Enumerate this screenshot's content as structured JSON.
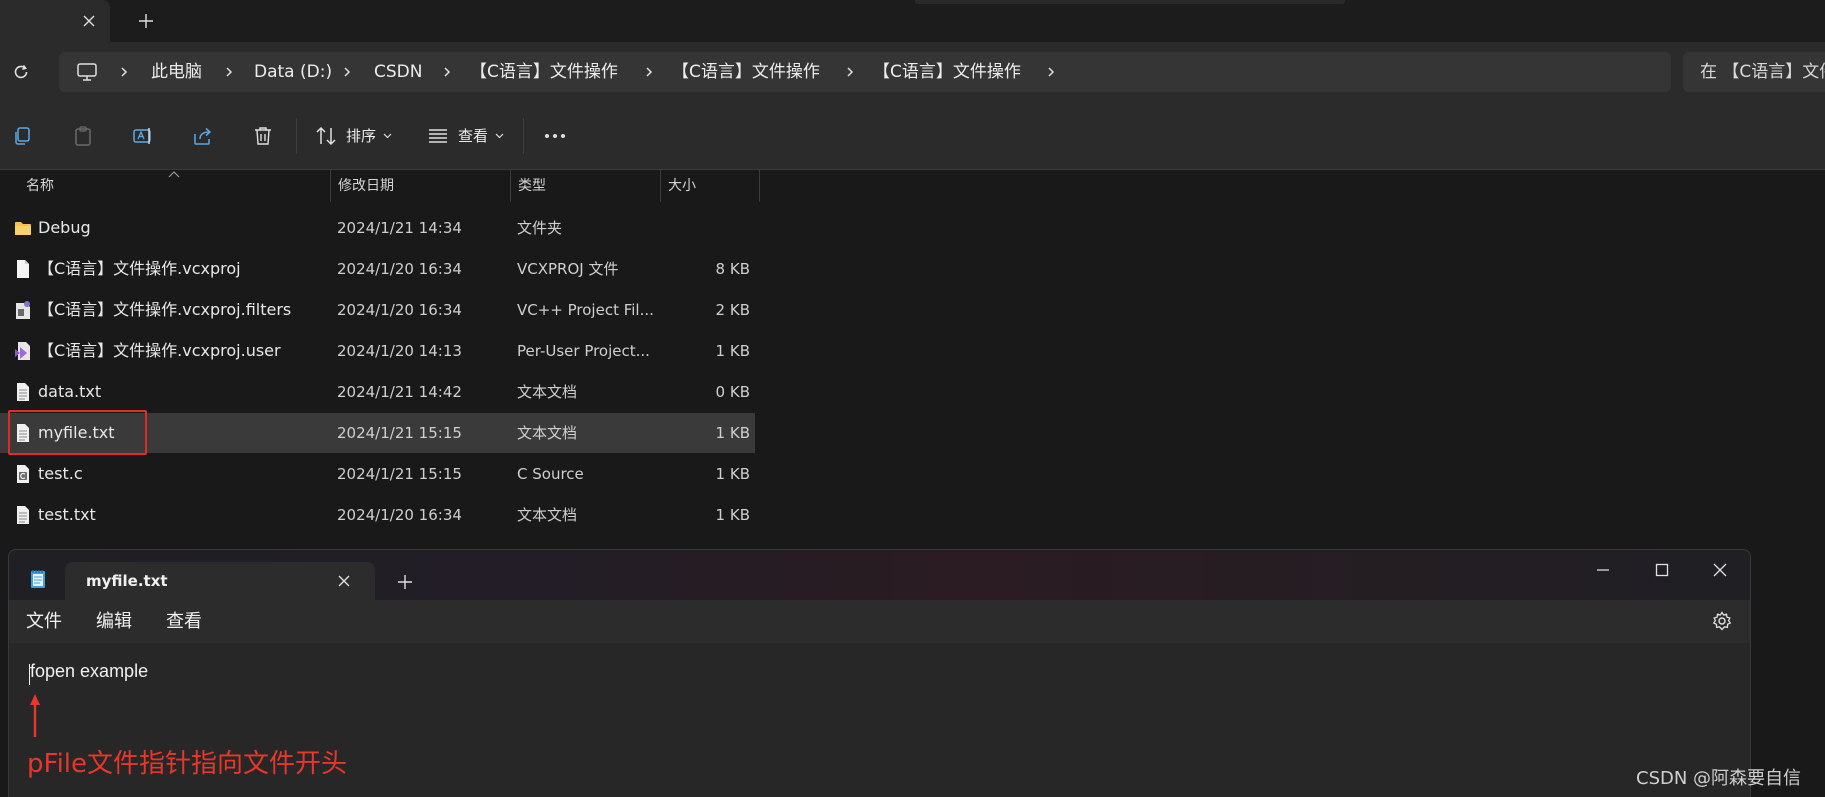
{
  "explorer": {
    "tab_close_icon": "close-icon",
    "new_tab_icon": "plus-icon",
    "address": {
      "root_icon": "computer-icon",
      "crumbs": [
        "此电脑",
        "Data (D:)",
        "CSDN",
        "【C语言】文件操作",
        "【C语言】文件操作",
        "【C语言】文件操作"
      ],
      "search_placeholder": "在 【C语言】文件操作 中搜索"
    },
    "commands": {
      "icons": [
        "copy-icon",
        "paste-icon",
        "rename-icon",
        "share-icon",
        "delete-icon"
      ],
      "sort_label": "排序",
      "view_label": "查看",
      "more_icon": "more-icon"
    },
    "columns": {
      "name": "名称",
      "date": "修改日期",
      "type": "类型",
      "size": "大小"
    },
    "files": [
      {
        "name": "Debug",
        "date": "2024/1/21 14:34",
        "type": "文件夹",
        "size": "",
        "icon": "folder-icon"
      },
      {
        "name": "【C语言】文件操作.vcxproj",
        "date": "2024/1/20 16:34",
        "type": "VCXPROJ 文件",
        "size": "8 KB",
        "icon": "file-icon"
      },
      {
        "name": "【C语言】文件操作.vcxproj.filters",
        "date": "2024/1/20 16:34",
        "type": "VC++ Project Fil...",
        "size": "2 KB",
        "icon": "project-filters-icon"
      },
      {
        "name": "【C语言】文件操作.vcxproj.user",
        "date": "2024/1/20 14:13",
        "type": "Per-User Project...",
        "size": "1 KB",
        "icon": "visual-studio-icon"
      },
      {
        "name": "data.txt",
        "date": "2024/1/21 14:42",
        "type": "文本文档",
        "size": "0 KB",
        "icon": "text-file-icon"
      },
      {
        "name": "myfile.txt",
        "date": "2024/1/21 15:15",
        "type": "文本文档",
        "size": "1 KB",
        "icon": "text-file-icon",
        "selected": true
      },
      {
        "name": "test.c",
        "date": "2024/1/21 15:15",
        "type": "C Source",
        "size": "1 KB",
        "icon": "c-source-icon"
      },
      {
        "name": "test.txt",
        "date": "2024/1/20 16:34",
        "type": "文本文档",
        "size": "1 KB",
        "icon": "text-file-icon"
      }
    ]
  },
  "notepad": {
    "app_icon": "notepad-icon",
    "tab_title": "myfile.txt",
    "menu": {
      "file": "文件",
      "edit": "编辑",
      "view": "查看"
    },
    "settings_icon": "gear-icon",
    "content": "fopen example"
  },
  "annotation": {
    "text": "pFile文件指针指向文件开头",
    "color": "#e8362b",
    "arrow_icon": "arrow-up-icon"
  },
  "watermark": "CSDN @阿森要自信"
}
